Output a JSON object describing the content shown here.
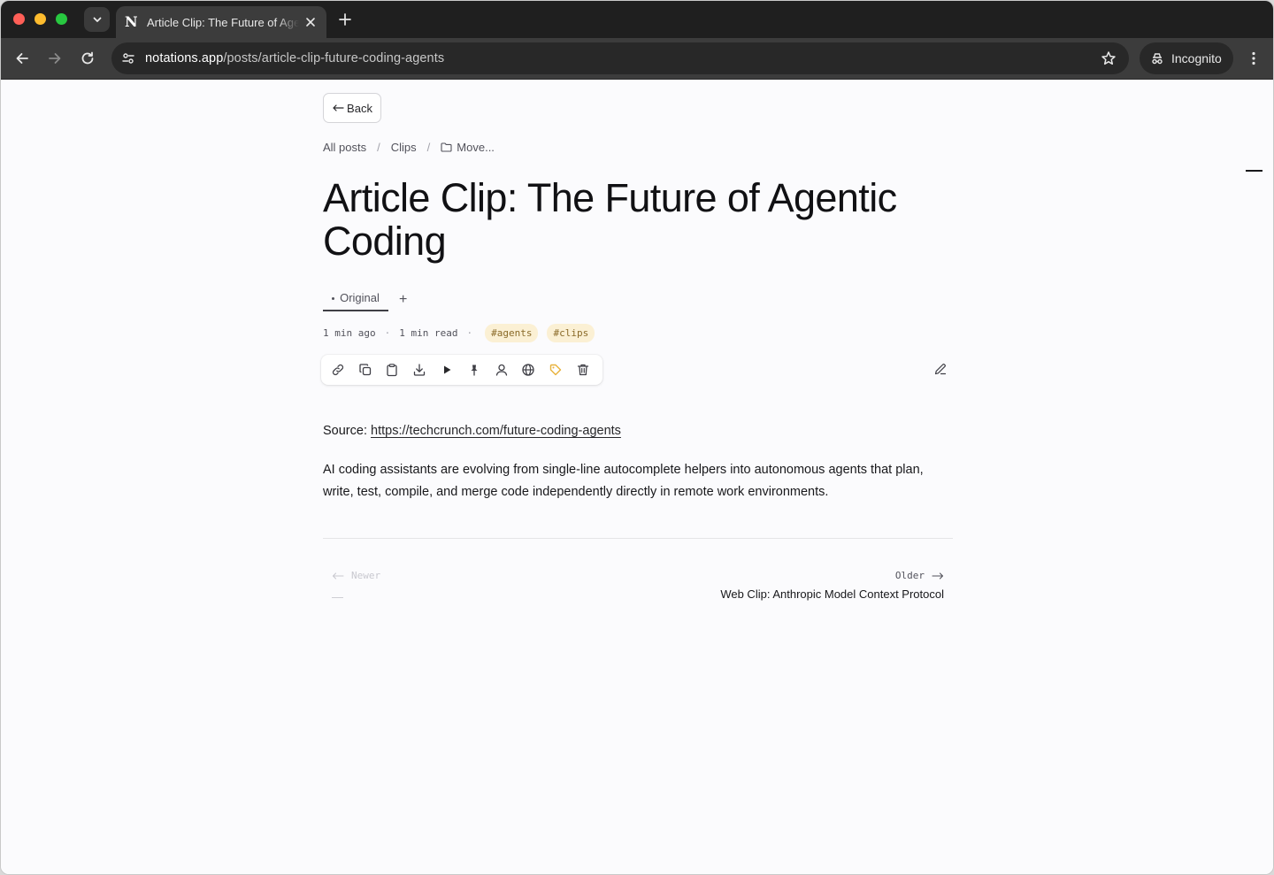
{
  "browser": {
    "tab_title": "Article Clip: The Future of Agentic Coding",
    "favicon_letter": "N",
    "url_host": "notations.app",
    "url_path": "/posts/article-clip-future-coding-agents",
    "incognito_label": "Incognito"
  },
  "page": {
    "back_label": "Back",
    "breadcrumb": {
      "all_posts": "All posts",
      "clips": "Clips",
      "move": "Move..."
    },
    "title": "Article Clip: The Future of Agentic Coding",
    "versions": {
      "original_label": "Original",
      "add_label": "+"
    },
    "meta": {
      "time_ago": "1 min ago",
      "read_time": "1 min read",
      "separator": "·",
      "tags": [
        "#agents",
        "#clips"
      ]
    },
    "actions": [
      "link-icon",
      "copy-icon",
      "clipboard-icon",
      "download-icon",
      "play-icon",
      "pin-icon",
      "person-icon",
      "globe-icon",
      "tag-icon",
      "trash-icon"
    ],
    "body": {
      "source_label": "Source:",
      "source_url": "https://techcrunch.com/future-coding-agents",
      "paragraph": "AI coding assistants are evolving from single-line autocomplete helpers into autonomous agents that plan, write, test, compile, and merge code independently directly in remote work environments."
    },
    "pager": {
      "newer_label": "Newer",
      "newer_title": "—",
      "older_label": "Older",
      "older_title": "Web Clip: Anthropic Model Context Protocol"
    }
  },
  "colors": {
    "tag_bg": "#fbf0d4",
    "tag_text": "#8a6a28",
    "tag_icon": "#e8b13a"
  }
}
